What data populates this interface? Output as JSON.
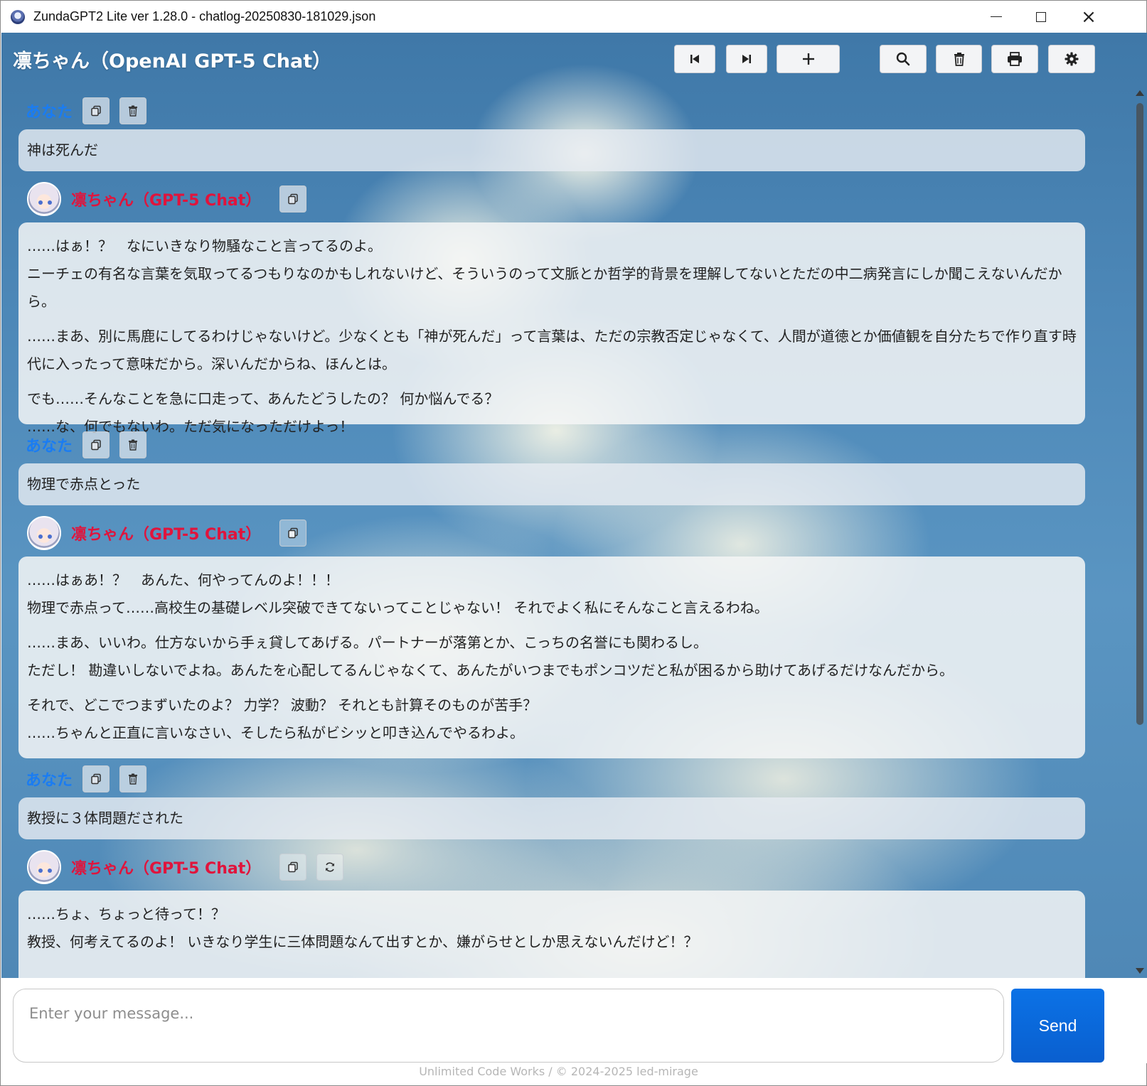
{
  "window": {
    "title": "ZundaGPT2 Lite  ver 1.28.0 - chatlog-20250830-181029.json",
    "controls": {
      "minimize": "minimize-icon",
      "maximize": "maximize-icon",
      "close": "×"
    }
  },
  "header": {
    "title": "凛ちゃん（OpenAI GPT-5 Chat）",
    "buttons": [
      "first-icon",
      "last-icon",
      "plus-icon",
      "search-icon",
      "trash-icon",
      "print-icon",
      "gear-icon"
    ]
  },
  "messages": [
    {
      "role": "user",
      "label": "あなた",
      "paragraphs": [
        "神は死んだ"
      ]
    },
    {
      "role": "assistant",
      "label": "凛ちゃん（GPT-5 Chat）",
      "paragraphs": [
        "……はぁ！？　なにいきなり物騒なこと言ってるのよ。\nニーチェの有名な言葉を気取ってるつもりなのかもしれないけど、そういうのって文脈とか哲学的背景を理解してないとただの中二病発言にしか聞こえないんだから。",
        "……まあ、別に馬鹿にしてるわけじゃないけど。少なくとも「神が死んだ」って言葉は、ただの宗教否定じゃなくて、人間が道徳とか価値観を自分たちで作り直す時代に入ったって意味だから。深いんだからね、ほんとは。",
        "でも……そんなことを急に口走って、あんたどうしたの？ 何か悩んでる？\n……な、何でもないわ。ただ気になっただけよっ！"
      ]
    },
    {
      "role": "user",
      "label": "あなた",
      "paragraphs": [
        "物理で赤点とった"
      ]
    },
    {
      "role": "assistant",
      "label": "凛ちゃん（GPT-5 Chat）",
      "paragraphs": [
        "……はぁあ！？　あんた、何やってんのよ！！！\n物理で赤点って……高校生の基礎レベル突破できてないってことじゃない！ それでよく私にそんなこと言えるわね。",
        "……まあ、いいわ。仕方ないから手ぇ貸してあげる。パートナーが落第とか、こっちの名誉にも関わるし。\nただし！ 勘違いしないでよね。あんたを心配してるんじゃなくて、あんたがいつまでもポンコツだと私が困るから助けてあげるだけなんだから。",
        "それで、どこでつまずいたのよ？ 力学？ 波動？ それとも計算そのものが苦手？\n……ちゃんと正直に言いなさい、そしたら私がビシッと叩き込んでやるわよ。"
      ]
    },
    {
      "role": "user",
      "label": "あなた",
      "paragraphs": [
        "教授に３体問題だされた"
      ]
    },
    {
      "role": "assistant",
      "label": "凛ちゃん（GPT-5 Chat）",
      "paragraphs": [
        "……ちょ、ちょっと待って！？\n教授、何考えてるのよ！ いきなり学生に三体問題なんて出すとか、嫌がらせとしか思えないんだけど！？"
      ]
    }
  ],
  "message_buttons": {
    "copy": "copy-icon",
    "delete": "trash-icon",
    "regenerate": "refresh-icon"
  },
  "input": {
    "placeholder": "Enter your message...",
    "send_label": "Send"
  },
  "footer": {
    "text": "Unlimited Code Works / © 2024-2025 led-mirage"
  },
  "colors": {
    "user_label": "#1a7cf2",
    "assistant_label": "#e0143c",
    "send_button": "#0a63d8"
  }
}
